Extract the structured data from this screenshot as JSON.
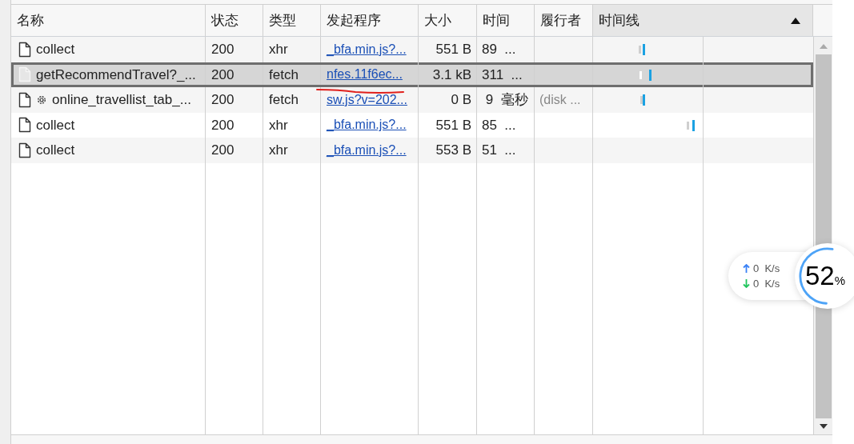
{
  "columns": [
    {
      "label": "名称",
      "sorted": false
    },
    {
      "label": "状态",
      "sorted": false
    },
    {
      "label": "类型",
      "sorted": false
    },
    {
      "label": "发起程序",
      "sorted": false
    },
    {
      "label": "大小",
      "sorted": false
    },
    {
      "label": "时间",
      "sorted": false
    },
    {
      "label": "履行者",
      "sorted": false
    },
    {
      "label": "时间线",
      "sorted": true
    }
  ],
  "rows": [
    {
      "name": "collect",
      "gear": false,
      "status": "200",
      "type": "xhr",
      "initiator": "_bfa.min.js?...",
      "size": "551 B",
      "time": "89  ...",
      "fulfiller": "",
      "selected": false
    },
    {
      "name": "getRecommendTravel?_...",
      "gear": false,
      "status": "200",
      "type": "fetch",
      "initiator": "nfes.11f6ec...",
      "size": "3.1 kB",
      "time": "311  ...",
      "fulfiller": "",
      "selected": true
    },
    {
      "name": "online_travellist_tab_...",
      "gear": true,
      "status": "200",
      "type": "fetch",
      "initiator": "sw.js?v=202...",
      "size": "0 B",
      "time": " 9  毫秒",
      "fulfiller": "(disk ...",
      "selected": false
    },
    {
      "name": "collect",
      "gear": false,
      "status": "200",
      "type": "xhr",
      "initiator": "_bfa.min.js?...",
      "size": "551 B",
      "time": "85  ...",
      "fulfiller": "",
      "selected": false
    },
    {
      "name": "collect",
      "gear": false,
      "status": "200",
      "type": "xhr",
      "initiator": "_bfa.min.js?...",
      "size": "553 B",
      "time": "51  ...",
      "fulfiller": "",
      "selected": false
    }
  ],
  "speed_widget": {
    "upload": "0  K/s",
    "download": "0  K/s",
    "percent": "52",
    "unit": "%",
    "level": 0.52
  }
}
